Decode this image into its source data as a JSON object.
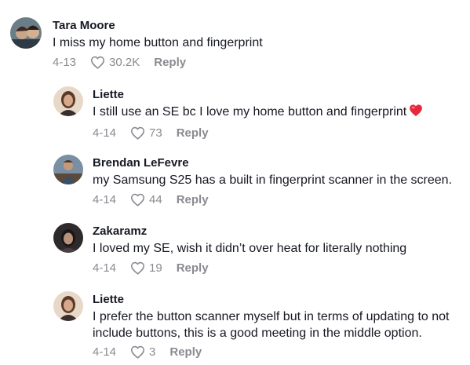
{
  "comments": [
    {
      "username": "Tara Moore",
      "text": "I miss my home button and fingerprint",
      "date": "4-13",
      "likes": "30.2K",
      "reply_label": "Reply"
    },
    {
      "username": "Liette",
      "text": "I still use an SE bc I love my home button and fingerprint",
      "emoji": "red-heart-emoji",
      "date": "4-14",
      "likes": "73",
      "reply_label": "Reply"
    },
    {
      "username": "Brendan LeFevre",
      "text": "my Samsung S25 has a built in fingerprint scanner in the screen.",
      "date": "4-14",
      "likes": "44",
      "reply_label": "Reply"
    },
    {
      "username": "Zakaramz",
      "text": "I loved my SE, wish it didn’t over heat for literally nothing",
      "date": "4-14",
      "likes": "19",
      "reply_label": "Reply"
    },
    {
      "username": "Liette",
      "text": "I prefer the button scanner myself but in terms of updating to not include buttons, this is a good meeting in the middle option.",
      "date": "4-14",
      "likes": "3",
      "reply_label": "Reply"
    }
  ],
  "icons": {
    "like": "heart-outline-icon"
  },
  "colors": {
    "text": "#161823",
    "secondary": "#8a8b91",
    "heart_emoji": "#e8293a"
  }
}
